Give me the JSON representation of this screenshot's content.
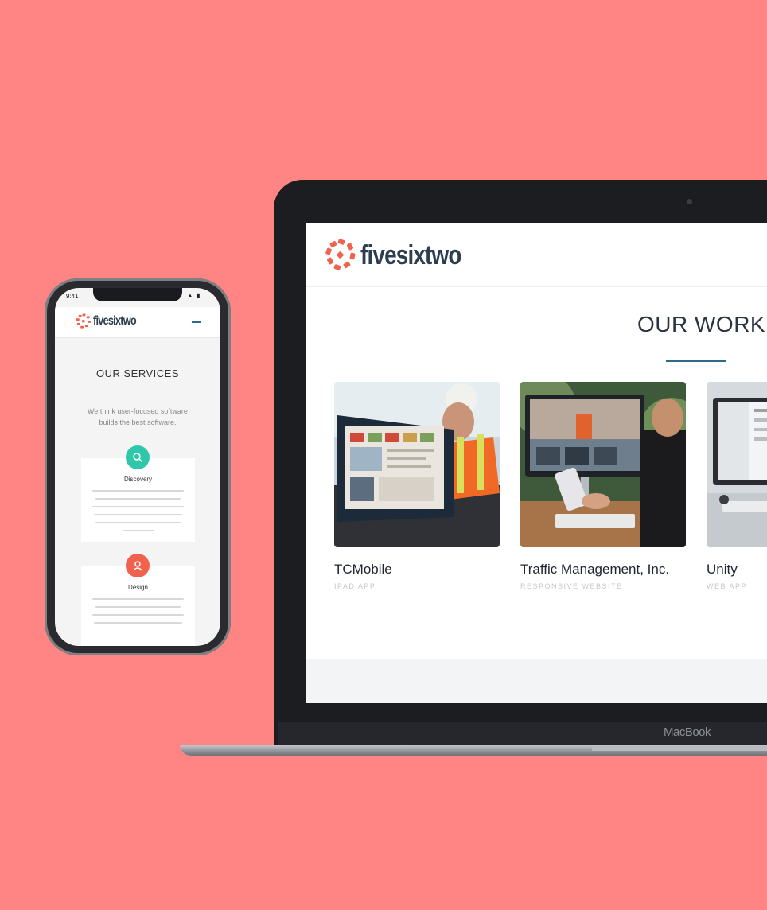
{
  "desktop": {
    "logo_text": "fivesixtwo",
    "section_title": "OUR WORK",
    "device_label": "MacBook",
    "projects": [
      {
        "title": "TCMobile",
        "type": "IPAD APP"
      },
      {
        "title": "Traffic Management, Inc.",
        "type": "RESPONSIVE WEBSITE"
      },
      {
        "title": "Unity",
        "type": "WEB APP"
      }
    ]
  },
  "mobile": {
    "status_time": "9:41",
    "status_icons": "▲ ▮",
    "logo_text": "fivesixtwo",
    "section_title": "OUR SERVICES",
    "subtitle": "We think user-focused software builds the best software.",
    "services": [
      {
        "title": "Discovery",
        "icon": "search-icon"
      },
      {
        "title": "Design",
        "icon": "user-icon"
      }
    ]
  },
  "colors": {
    "background": "#ff8585",
    "brand_navy": "#2d3e50",
    "brand_red": "#f0624d",
    "accent_teal": "#2fc7a9",
    "accent_blue": "#2d6b8e"
  }
}
